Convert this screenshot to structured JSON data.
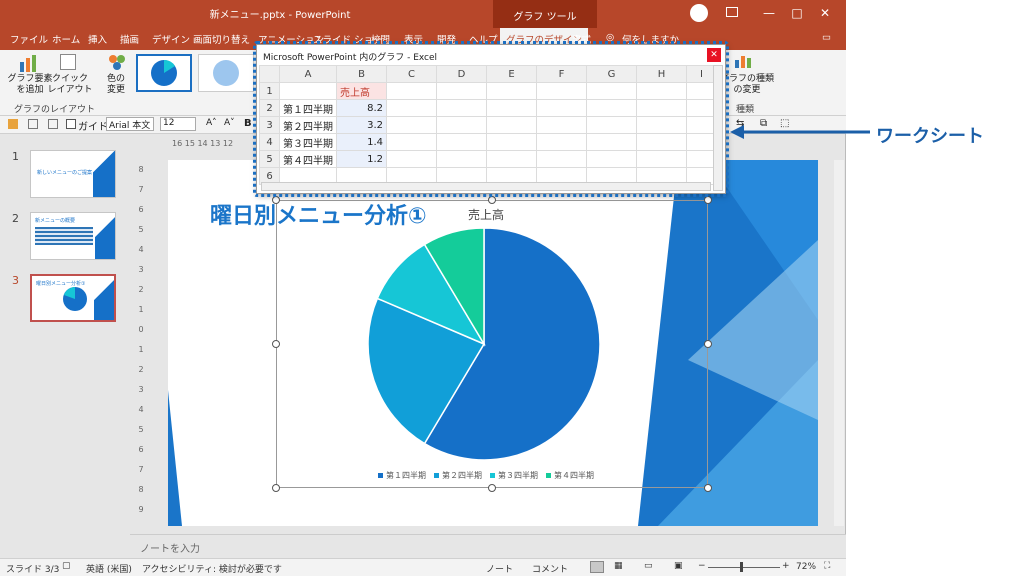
{
  "window": {
    "title": "新メニュー.pptx  -  PowerPoint",
    "contextual_tab_group": "グラフ ツール",
    "controls": [
      "—",
      "□",
      "✕"
    ]
  },
  "tabs": [
    "ファイル",
    "ホーム",
    "挿入",
    "描画",
    "デザイン",
    "画面切り替え",
    "アニメーション",
    "スライド ショー",
    "校閲",
    "表示",
    "開発",
    "ヘルプ",
    "グラフのデザイン",
    "書式",
    "何をしますか"
  ],
  "active_tab": "グラフのデザイン",
  "ribbon": {
    "add_element": "グラフ要素\nを追加",
    "quick_layout": "クイック\nレイアウト",
    "change_colors": "色の\n変更",
    "group_layout": "グラフのレイアウト",
    "change_type": "グラフの種類\nの変更",
    "group_type": "種類"
  },
  "format_bar": {
    "guide_label": "ガイド",
    "font": "Arial 本文",
    "size": "12"
  },
  "thumbnails": [
    {
      "num": "1",
      "title": "新しいメニューのご提案"
    },
    {
      "num": "2",
      "title": "新メニューの概要"
    },
    {
      "num": "3",
      "title": "曜日別メニュー分析①"
    }
  ],
  "ruler_text": "16 15 14 13 12",
  "slide": {
    "title": "曜日別メニュー分析①",
    "chart_title": "売上高"
  },
  "chart_data": {
    "type": "pie",
    "title": "売上高",
    "categories": [
      "第１四半期",
      "第２四半期",
      "第３四半期",
      "第４四半期"
    ],
    "values": [
      8.2,
      3.2,
      1.4,
      1.2
    ],
    "colors": [
      "#1570c8",
      "#119fd8",
      "#16c6d6",
      "#14cc9a"
    ],
    "legend": "bottom"
  },
  "excel": {
    "title": "Microsoft PowerPoint 内のグラフ - Excel",
    "columns": [
      "A",
      "B",
      "C",
      "D",
      "E",
      "F",
      "G",
      "H",
      "I"
    ],
    "rows": [
      {
        "n": "1",
        "a": "",
        "b": "売上高"
      },
      {
        "n": "2",
        "a": "第１四半期",
        "b": "8.2"
      },
      {
        "n": "3",
        "a": "第２四半期",
        "b": "3.2"
      },
      {
        "n": "4",
        "a": "第３四半期",
        "b": "1.4"
      },
      {
        "n": "5",
        "a": "第４四半期",
        "b": "1.2"
      },
      {
        "n": "6",
        "a": "",
        "b": ""
      }
    ]
  },
  "notes_placeholder": "ノートを入力",
  "status": {
    "slide": "スライド 3/3",
    "lang": "英語 (米国)",
    "accessibility": "アクセシビリティ: 検討が必要です",
    "notes": "ノート",
    "comments": "コメント",
    "zoom": "72%"
  },
  "annotation": "ワークシート",
  "colors": {
    "brand": "#b7472a",
    "accent": "#1b5fa8"
  }
}
